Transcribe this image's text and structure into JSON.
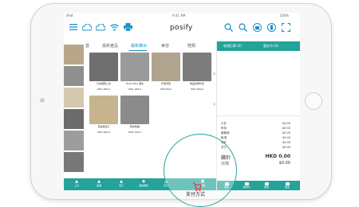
{
  "status_bar": {
    "left": "iPad",
    "center": "9:41 AM",
    "right": "100%"
  },
  "app": {
    "brand": "posify"
  },
  "product_tabs": [
    {
      "label": "基",
      "active": false
    },
    {
      "label": "最新產品",
      "active": false
    },
    {
      "label": "最新推出",
      "active": true
    },
    {
      "label": "美容",
      "active": false
    },
    {
      "label": "鞋類",
      "active": false
    }
  ],
  "products_row1": [
    {
      "name": "日本服飾上衣",
      "price": "HKD 289.0"
    },
    {
      "name": "Hello Kitty 襯衫",
      "price": "HKD 189.0"
    },
    {
      "name": "珍珠耳環",
      "price": "HKD 89.0"
    },
    {
      "name": "精品休閒外套",
      "price": "HKD 489.0"
    }
  ],
  "products_row2": [
    {
      "name": "英倫風靴子",
      "price": "HKD 690.0"
    },
    {
      "name": "時尚短裙",
      "price": "HKD 150.0"
    }
  ],
  "category_bar": [
    {
      "label": "上衣"
    },
    {
      "label": "長褲"
    },
    {
      "label": "鞋子"
    },
    {
      "label": "運動服裝"
    },
    {
      "label": "手袋"
    }
  ],
  "category_extra": {
    "label": "標籤"
  },
  "bottom_nav": [
    {
      "label": "銷售"
    },
    {
      "label": "會員"
    },
    {
      "label": "訂單"
    },
    {
      "label": "報告"
    }
  ],
  "right_panel": {
    "tab1": "新增訂單 (0)",
    "tab2": "暫存中 (0)",
    "summary": [
      {
        "label": "小計",
        "value": "$0.00"
      },
      {
        "label": "折扣",
        "value": "-$0.00"
      },
      {
        "label": "服務費",
        "value": "$0.00"
      },
      {
        "label": "稅項",
        "value": "$0.00"
      },
      {
        "label": "總計",
        "value": "$0.00"
      },
      {
        "label": "實收",
        "value": "$0.00"
      }
    ],
    "total_label": "總計",
    "total_value": "HKD 0.00",
    "change_label": "找贖",
    "change_value": "$0.00",
    "pay_buttons": [
      {
        "label": "現金"
      },
      {
        "label": "信用卡"
      },
      {
        "label": "其他"
      },
      {
        "label": "更多"
      }
    ]
  },
  "payment_method_label": "支付方式",
  "cart_badge": "0"
}
